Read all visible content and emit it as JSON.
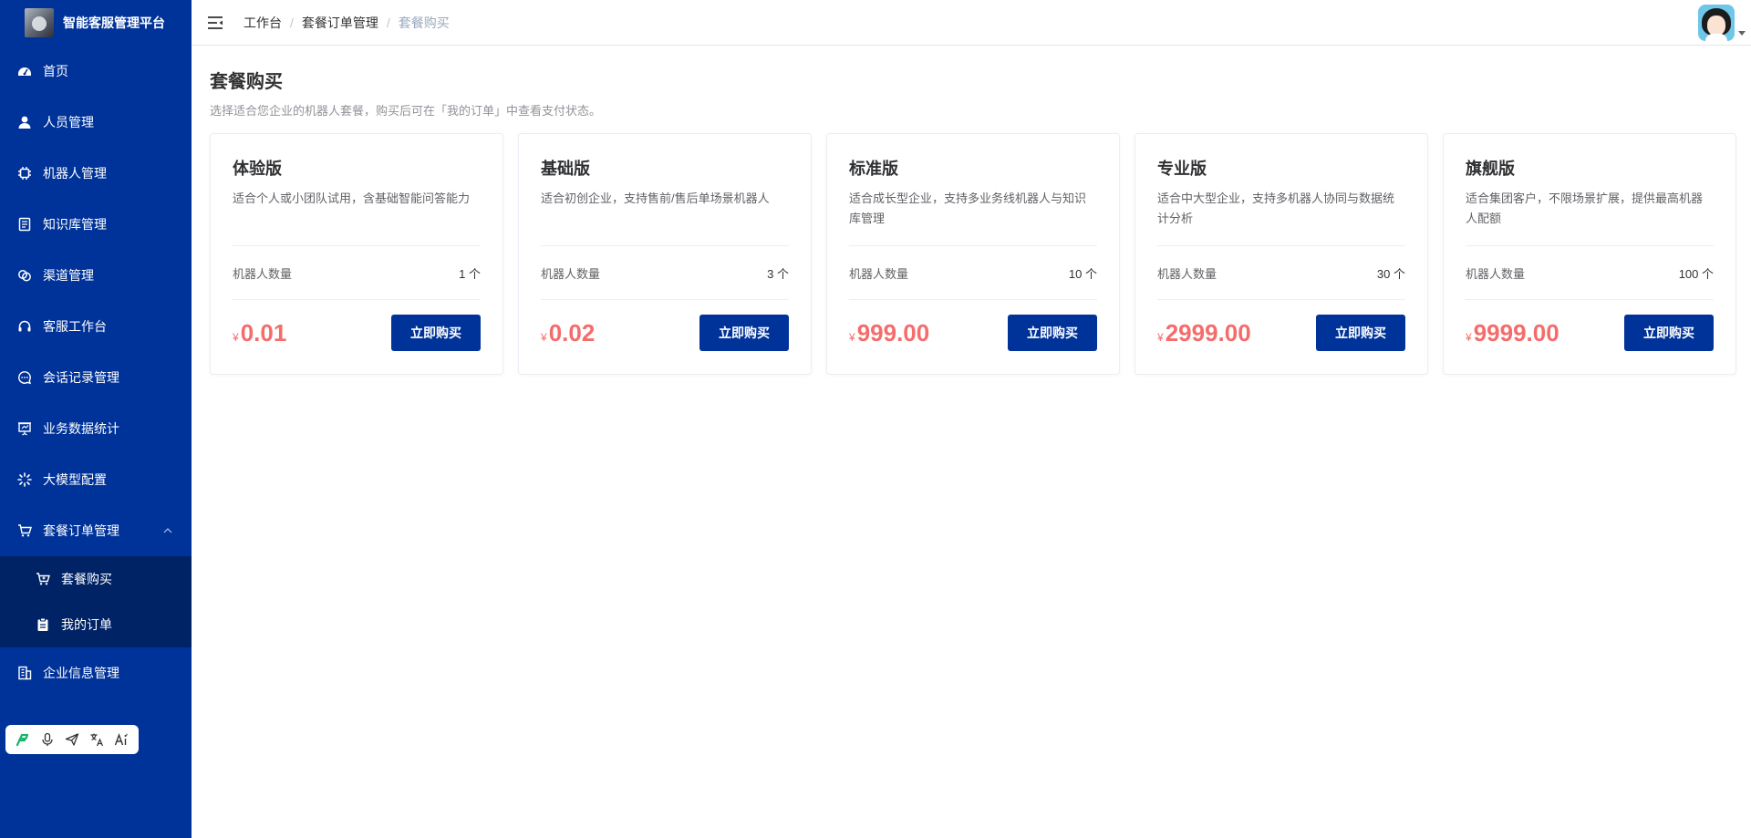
{
  "brand": {
    "title": "智能客服管理平台"
  },
  "sidebar": {
    "items": [
      {
        "label": "首页",
        "icon": "dashboard-icon"
      },
      {
        "label": "人员管理",
        "icon": "user-icon"
      },
      {
        "label": "机器人管理",
        "icon": "chip-icon"
      },
      {
        "label": "知识库管理",
        "icon": "document-icon"
      },
      {
        "label": "渠道管理",
        "icon": "link-icon"
      },
      {
        "label": "客服工作台",
        "icon": "headset-icon"
      },
      {
        "label": "会话记录管理",
        "icon": "chat-icon"
      },
      {
        "label": "业务数据统计",
        "icon": "presentation-icon"
      },
      {
        "label": "大模型配置",
        "icon": "loading-icon"
      },
      {
        "label": "套餐订单管理",
        "icon": "cart-icon",
        "expanded": true
      },
      {
        "label": "企业信息管理",
        "icon": "building-icon"
      }
    ],
    "subitems": [
      {
        "label": "套餐购买",
        "icon": "cart-icon"
      },
      {
        "label": "我的订单",
        "icon": "clipboard-icon"
      }
    ]
  },
  "header": {
    "breadcrumb": [
      "工作台",
      "套餐订单管理",
      "套餐购买"
    ]
  },
  "page": {
    "title": "套餐购买",
    "description": "选择适合您企业的机器人套餐，购买后可在「我的订单」中查看支付状态。"
  },
  "plans": [
    {
      "name": "体验版",
      "desc": "适合个人或小团队试用，含基础智能问答能力",
      "qty_label": "机器人数量",
      "qty": "1 个",
      "currency": "¥",
      "price": "0.01",
      "button": "立即购买"
    },
    {
      "name": "基础版",
      "desc": "适合初创企业，支持售前/售后单场景机器人",
      "qty_label": "机器人数量",
      "qty": "3 个",
      "currency": "¥",
      "price": "0.02",
      "button": "立即购买"
    },
    {
      "name": "标准版",
      "desc": "适合成长型企业，支持多业务线机器人与知识库管理",
      "qty_label": "机器人数量",
      "qty": "10 个",
      "currency": "¥",
      "price": "999.00",
      "button": "立即购买"
    },
    {
      "name": "专业版",
      "desc": "适合中大型企业，支持多机器人协同与数据统计分析",
      "qty_label": "机器人数量",
      "qty": "30 个",
      "currency": "¥",
      "price": "2999.00",
      "button": "立即购买"
    },
    {
      "name": "旗舰版",
      "desc": "适合集团客户，不限场景扩展，提供最高机器人配额",
      "qty_label": "机器人数量",
      "qty": "100 个",
      "currency": "¥",
      "price": "9999.00",
      "button": "立即购买"
    }
  ],
  "colors": {
    "sidebar": "#003399",
    "submenu": "#002366",
    "price": "#f56c6c",
    "button": "#003399"
  }
}
